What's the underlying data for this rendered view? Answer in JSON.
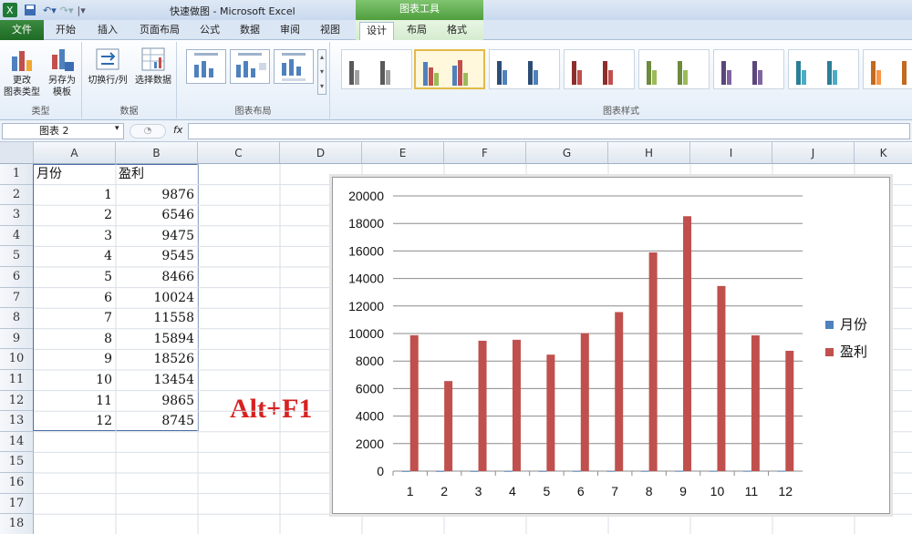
{
  "window": {
    "title": "快速做图 - Microsoft Excel",
    "context_title": "图表工具",
    "app_icon": "excel-icon"
  },
  "tabs": [
    "文件",
    "开始",
    "插入",
    "页面布局",
    "公式",
    "数据",
    "审阅",
    "视图",
    "设计",
    "布局",
    "格式"
  ],
  "active_tab": "设计",
  "ribbon": {
    "type_group": {
      "label": "类型",
      "change_type": "更改\n图表类型",
      "save_template": "另存为\n模板"
    },
    "data_group": {
      "label": "数据",
      "switch": "切换行/列",
      "select": "选择数据"
    },
    "layout_group": {
      "label": "图表布局"
    },
    "style_group": {
      "label": "图表样式"
    }
  },
  "formula_bar": {
    "name_box": "图表 2",
    "fx": "fx",
    "formula": ""
  },
  "columns": [
    "A",
    "B",
    "C",
    "D",
    "E",
    "F",
    "G",
    "H",
    "I",
    "J",
    "K"
  ],
  "rows": [
    "1",
    "2",
    "3",
    "4",
    "5",
    "6",
    "7",
    "8",
    "9",
    "10",
    "11",
    "12",
    "13",
    "14",
    "15",
    "16",
    "17",
    "18"
  ],
  "sheet": {
    "headers": [
      "月份",
      "盈利"
    ],
    "months": [
      "1",
      "2",
      "3",
      "4",
      "5",
      "6",
      "7",
      "8",
      "9",
      "10",
      "11",
      "12"
    ],
    "profits": [
      "9876",
      "6546",
      "9475",
      "9545",
      "8466",
      "10024",
      "11558",
      "15894",
      "18526",
      "13454",
      "9865",
      "8745"
    ]
  },
  "annotation": "Alt+F1",
  "chart_data": {
    "type": "bar",
    "categories": [
      "1",
      "2",
      "3",
      "4",
      "5",
      "6",
      "7",
      "8",
      "9",
      "10",
      "11",
      "12"
    ],
    "series": [
      {
        "name": "月份",
        "values": [
          1,
          2,
          3,
          4,
          5,
          6,
          7,
          8,
          9,
          10,
          11,
          12
        ],
        "color": "#4f81bd"
      },
      {
        "name": "盈利",
        "values": [
          9876,
          6546,
          9475,
          9545,
          8466,
          10024,
          11558,
          15894,
          18526,
          13454,
          9865,
          8745
        ],
        "color": "#c0504d"
      }
    ],
    "ylim": [
      0,
      20000
    ],
    "yticks": [
      "0",
      "2000",
      "4000",
      "6000",
      "8000",
      "10000",
      "12000",
      "14000",
      "16000",
      "18000",
      "20000"
    ],
    "grid": true,
    "legend": "right"
  }
}
